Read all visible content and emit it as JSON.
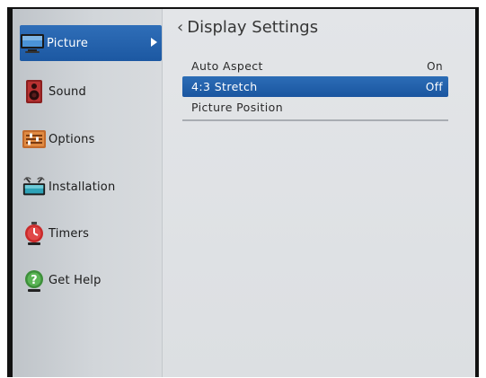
{
  "sidebar": {
    "items": [
      {
        "label": "Picture",
        "icon": "tv-icon",
        "selected": true
      },
      {
        "label": "Sound",
        "icon": "speaker-icon",
        "selected": false
      },
      {
        "label": "Options",
        "icon": "options-icon",
        "selected": false
      },
      {
        "label": "Installation",
        "icon": "antenna-icon",
        "selected": false
      },
      {
        "label": "Timers",
        "icon": "timer-icon",
        "selected": false
      },
      {
        "label": "Get Help",
        "icon": "help-icon",
        "selected": false
      }
    ]
  },
  "main": {
    "title": "Display Settings",
    "rows": [
      {
        "label": "Auto Aspect",
        "value": "On",
        "selected": false
      },
      {
        "label": "4:3 Stretch",
        "value": "Off",
        "selected": true
      },
      {
        "label": "Picture Position",
        "value": "",
        "selected": false
      }
    ]
  },
  "colors": {
    "highlight": "#1f5ea8",
    "sidebar_bg": "#c8ccd0",
    "panel_bg": "#dfe1e4"
  }
}
